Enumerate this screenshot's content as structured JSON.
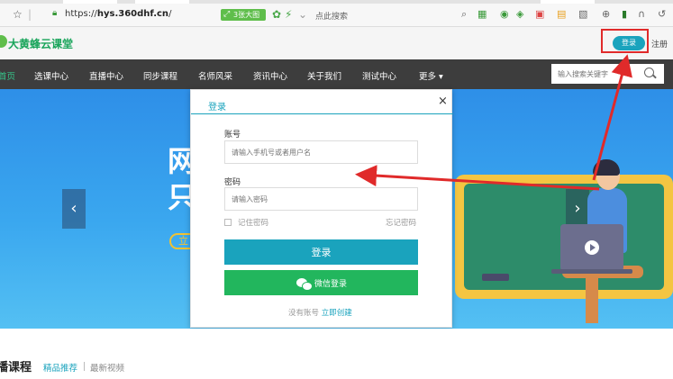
{
  "browser": {
    "url_prefix": "https://",
    "url_domain": "hys.360dhf.cn",
    "url_suffix": "/",
    "ext_pill": "3张大图",
    "search_hint": "点此搜索"
  },
  "header": {
    "site_name": "大黄蜂云课堂",
    "login_label": "登录",
    "register_label": "注册"
  },
  "nav": {
    "items": [
      "首页",
      "选课中心",
      "直播中心",
      "同步课程",
      "名师风采",
      "资讯中心",
      "关于我们",
      "测试中心",
      "更多"
    ],
    "search_placeholder": "输入搜索关键字"
  },
  "hero": {
    "headline_1": "网",
    "headline_2": "只",
    "pill": "立"
  },
  "modal": {
    "title": "登录",
    "close": "×",
    "account_label": "账号",
    "account_placeholder": "请输入手机号或者用户名",
    "password_label": "密码",
    "password_placeholder": "请输入密码",
    "remember_label": "记住密码",
    "forgot_label": "忘记密码",
    "submit_label": "登录",
    "wechat_label": "微信登录",
    "no_account_text": "没有账号",
    "create_link": "立即创建"
  },
  "section": {
    "title": "播课程",
    "tab_featured": "精品推荐",
    "tab_latest": "最新视频"
  },
  "colors": {
    "accent": "#1aa3bd",
    "wechat": "#22b65d",
    "brand": "#18a45a",
    "annotation": "#e02a2a"
  }
}
